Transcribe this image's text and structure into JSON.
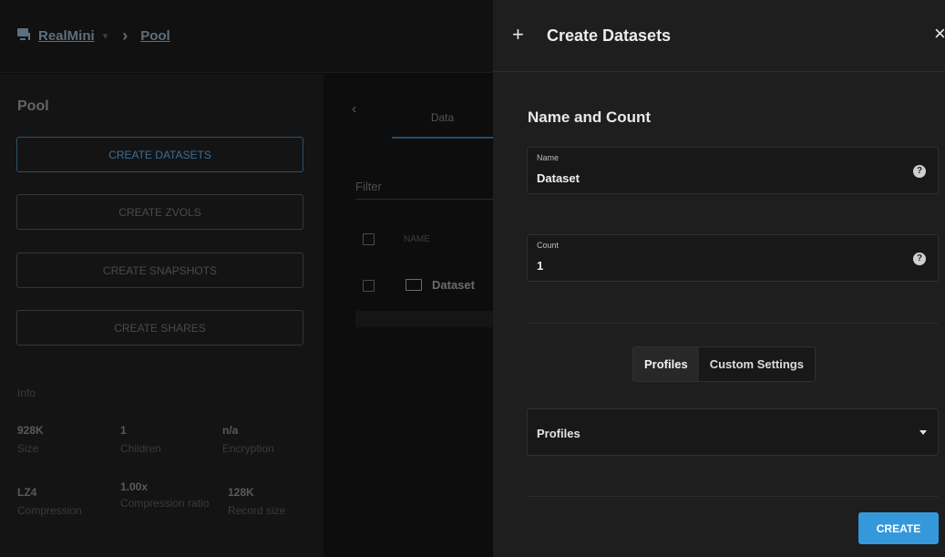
{
  "breadcrumb": {
    "host": "RealMini",
    "separator": "›",
    "location": "Pool"
  },
  "sidebar": {
    "title": "Pool",
    "buttons": [
      {
        "label": "CREATE DATASETS"
      },
      {
        "label": "CREATE ZVOLS"
      },
      {
        "label": "CREATE SNAPSHOTS"
      },
      {
        "label": "CREATE SHARES"
      }
    ],
    "info": {
      "title": "Info",
      "items": [
        {
          "value": "928K",
          "key": "Size"
        },
        {
          "value": "1",
          "key": "Children"
        },
        {
          "value": "n/a",
          "key": "Encryption"
        },
        {
          "value": "LZ4",
          "key": "Compression"
        },
        {
          "value": "1.00x",
          "key": "Compression ratio"
        },
        {
          "value": "128K",
          "key": "Record size"
        }
      ]
    }
  },
  "content": {
    "back_label": "‹",
    "tab_label": "Data",
    "filter_label": "Filter",
    "column_name": "NAME",
    "rows": [
      {
        "name": "Dataset"
      }
    ]
  },
  "panel": {
    "plus": "+",
    "title": "Create Datasets",
    "close": "×",
    "section_title": "Name and Count",
    "name_field": {
      "label": "Name",
      "value": "Dataset"
    },
    "count_field": {
      "label": "Count",
      "value": "1"
    },
    "help_glyph": "?",
    "toggle": {
      "options": [
        "Profiles",
        "Custom Settings"
      ],
      "active": "Profiles"
    },
    "profiles_select": {
      "label": "Profiles"
    },
    "create_label": "CREATE"
  },
  "colors": {
    "accent": "#3498db",
    "panel_bg": "#1e1e1e"
  }
}
